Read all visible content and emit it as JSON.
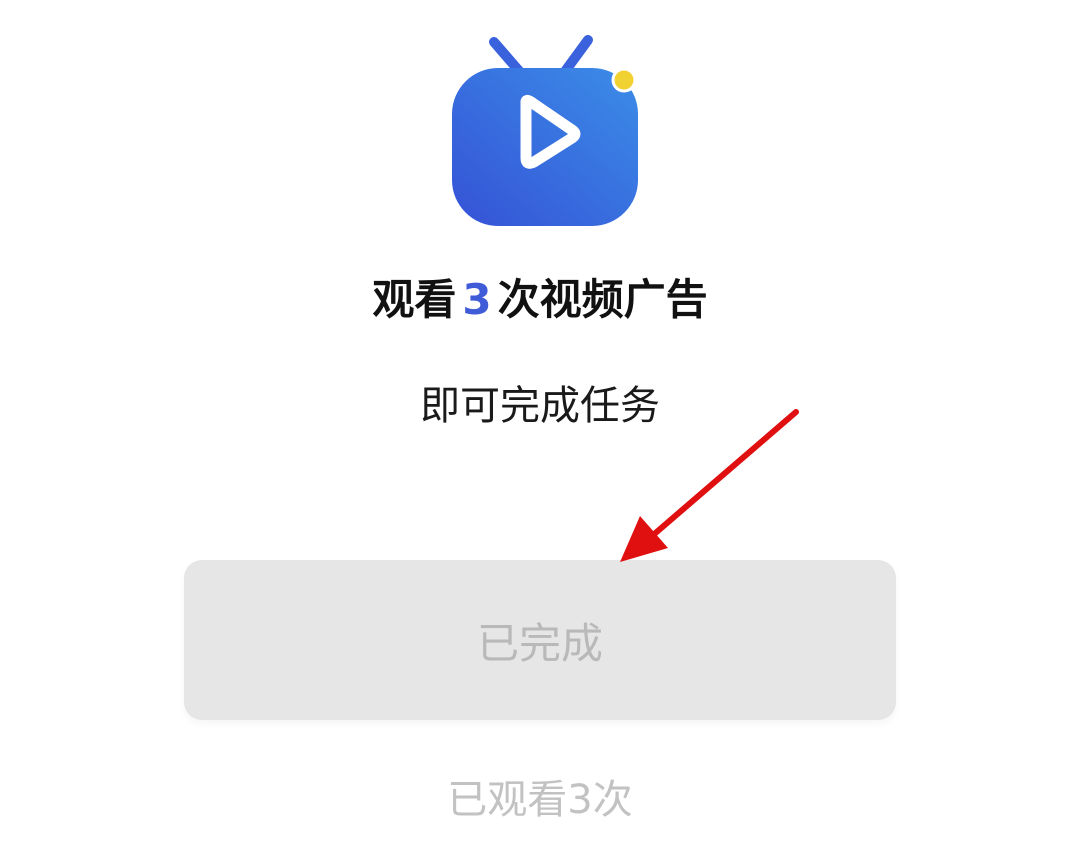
{
  "icon": {
    "name": "tv-play-icon",
    "colors": {
      "body_start": "#3a56d8",
      "body_end": "#3a8ae8",
      "play": "#ffffff",
      "dot": "#f2d233"
    }
  },
  "task": {
    "title_prefix": "观看",
    "title_count": "3",
    "title_suffix": "次视频广告",
    "subtitle": "即可完成任务"
  },
  "button": {
    "label": "已完成",
    "state": "disabled"
  },
  "status": {
    "watched_text": "已观看3次"
  },
  "annotation": {
    "type": "arrow",
    "color": "#e01010"
  }
}
